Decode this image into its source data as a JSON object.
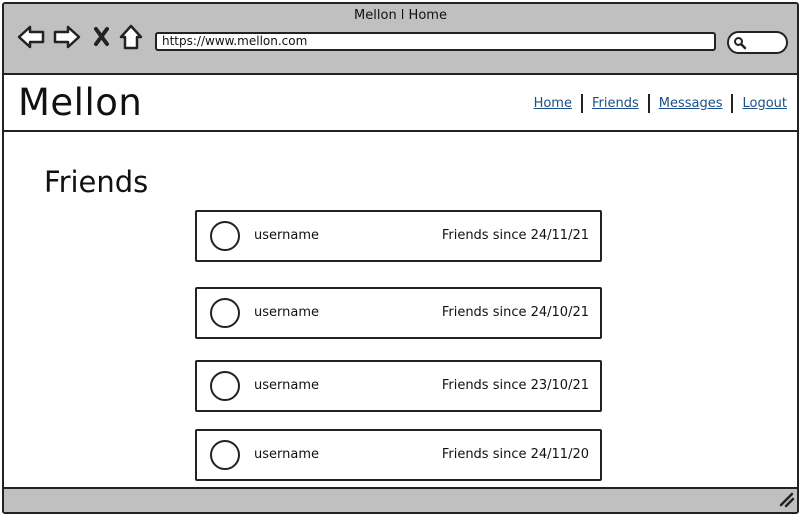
{
  "window": {
    "title": "Mellon l Home"
  },
  "browser": {
    "url": "https://www.mellon.com",
    "icons": [
      "back-arrow-icon",
      "forward-arrow-icon",
      "close-x-icon",
      "home-icon",
      "search-icon"
    ]
  },
  "site": {
    "logo": "Mellon",
    "nav": {
      "home": "Home",
      "friends": "Friends",
      "messages": "Messages",
      "logout": "Logout"
    }
  },
  "main": {
    "title": "Friends",
    "friends": [
      {
        "username": "username",
        "since": "Friends since 24/11/21"
      },
      {
        "username": "username",
        "since": "Friends since 24/10/21"
      },
      {
        "username": "username",
        "since": "Friends since 23/10/21"
      },
      {
        "username": "username",
        "since": "Friends since 24/11/20"
      }
    ]
  },
  "colors": {
    "chrome": "#c0c0c0",
    "link": "#1a4f8a",
    "stroke": "#222222"
  }
}
